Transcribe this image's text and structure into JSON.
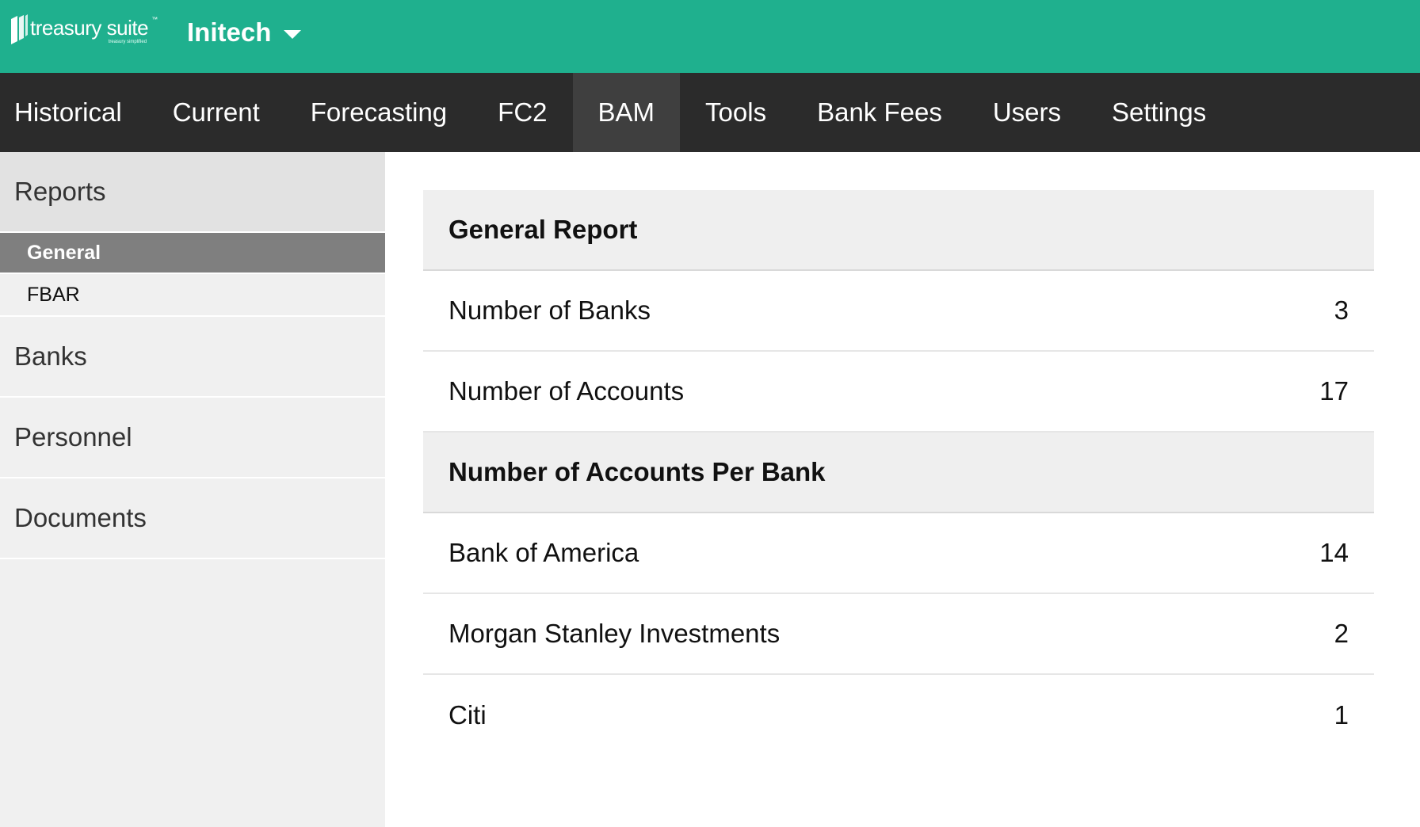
{
  "brand": {
    "logo_text": "treasury suite",
    "logo_tm": "™",
    "logo_tagline": "treasury simplified",
    "primary_color": "#1fb08e",
    "nav_color": "#2b2b2b"
  },
  "org": {
    "name": "Initech",
    "dropdown_icon": "caret-down-icon"
  },
  "nav": {
    "items": [
      {
        "label": "Historical"
      },
      {
        "label": "Current"
      },
      {
        "label": "Forecasting"
      },
      {
        "label": "FC2"
      },
      {
        "label": "BAM",
        "active": true
      },
      {
        "label": "Tools"
      },
      {
        "label": "Bank Fees"
      },
      {
        "label": "Users"
      },
      {
        "label": "Settings"
      }
    ]
  },
  "sidebar": {
    "reports": {
      "label": "Reports",
      "items": [
        {
          "label": "General",
          "active": true
        },
        {
          "label": "FBAR"
        }
      ]
    },
    "banks": {
      "label": "Banks"
    },
    "personnel": {
      "label": "Personnel"
    },
    "documents": {
      "label": "Documents"
    }
  },
  "report": {
    "general_title": "General Report",
    "summary": [
      {
        "label": "Number of Banks",
        "value": "3"
      },
      {
        "label": "Number of Accounts",
        "value": "17"
      }
    ],
    "per_bank_title": "Number of Accounts Per Bank",
    "per_bank": [
      {
        "label": "Bank of America",
        "value": "14"
      },
      {
        "label": "Morgan Stanley Investments",
        "value": "2"
      },
      {
        "label": "Citi",
        "value": "1"
      }
    ]
  }
}
